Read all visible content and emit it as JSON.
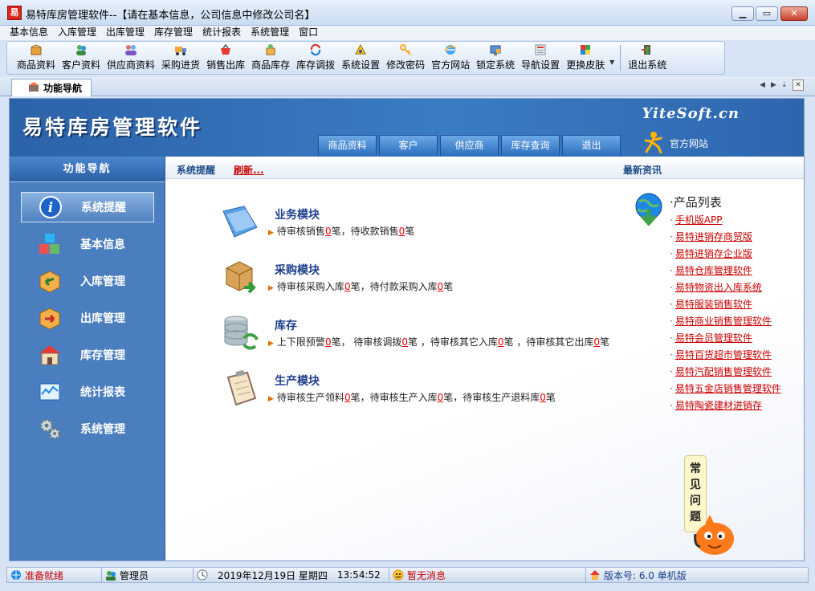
{
  "window": {
    "icon_char": "易",
    "title": "易特库房管理软件--【请在基本信息，公司信息中修改公司名】",
    "minimize": "▁",
    "maximize": "▭",
    "close": "✕"
  },
  "menu": [
    "基本信息",
    "入库管理",
    "出库管理",
    "库存管理",
    "统计报表",
    "系统管理",
    "窗口"
  ],
  "toolbar": [
    {
      "label": "商品资料",
      "icon": "box-icon"
    },
    {
      "label": "客户资料",
      "icon": "customers-icon"
    },
    {
      "label": "供应商资料",
      "icon": "suppliers-icon"
    },
    {
      "label": "采购进货",
      "icon": "truck-icon"
    },
    {
      "label": "销售出库",
      "icon": "basket-icon"
    },
    {
      "label": "商品库存",
      "icon": "stock-icon"
    },
    {
      "label": "库存调拨",
      "icon": "transfer-icon"
    },
    {
      "label": "系统设置",
      "icon": "settings-icon"
    },
    {
      "label": "修改密码",
      "icon": "key-icon"
    },
    {
      "label": "官方网站",
      "icon": "browser-icon"
    },
    {
      "label": "锁定系统",
      "icon": "lock-icon"
    },
    {
      "label": "导航设置",
      "icon": "nav-icon"
    },
    {
      "label": "更换皮肤",
      "icon": "skin-icon"
    },
    {
      "label": "退出系统",
      "icon": "exit-icon"
    }
  ],
  "tab": {
    "label": "功能导航"
  },
  "banner": {
    "title": "易特库房管理软件",
    "brand": "YiteSoft.cn",
    "tabs": [
      "商品资料",
      "客户",
      "供应商",
      "库存查询",
      "退出"
    ],
    "site_label": "官方网站"
  },
  "sidebar": {
    "title": "功能导航",
    "items": [
      "系统提醒",
      "基本信息",
      "入库管理",
      "出库管理",
      "库存管理",
      "统计报表",
      "系统管理"
    ]
  },
  "crumb": {
    "title": "系统提醒",
    "refresh": "刷新...",
    "news": "最新资讯"
  },
  "modules": {
    "business": {
      "title": "业务模块",
      "t1": "待审核销售",
      "n1": "0",
      "t2": "笔，待收款销售",
      "n2": "0",
      "t3": "笔"
    },
    "purchase": {
      "title": "采购模块",
      "t1": "待审核采购入库",
      "n1": "0",
      "t2": "笔，待付款采购入库",
      "n2": "0",
      "t3": "笔"
    },
    "stock": {
      "title": "库存",
      "t1": "上下限预警",
      "n1": "0",
      "t2": "笔，  待审核调拨",
      "n2": "0",
      "t3": "笔 ，待审核其它入库",
      "n3": "0",
      "t4": "笔 ，待审核其它出库",
      "n4": "0",
      "t5": "笔"
    },
    "production": {
      "title": "生产模块",
      "t1": "待审核生产领料",
      "n1": "0",
      "t2": "笔，待审核生产入库",
      "n2": "0",
      "t3": "笔，待审核生产退料库",
      "n3": "0",
      "t4": "笔"
    }
  },
  "products": {
    "heading": "产品列表",
    "items": [
      "手机版APP",
      "易特进销存商贸版",
      "易特进销存企业版",
      "易特仓库管理软件",
      "易特物资出入库系统",
      "易特服装销售软件",
      "易特商业销售管理软件",
      "易特会员管理软件",
      "易特百货超市管理软件",
      "易特汽配销售管理软件",
      "易特五金店销售管理软件",
      "易特陶瓷建材进销存"
    ]
  },
  "faq": {
    "line1": "常",
    "line2": "见",
    "line3": "问",
    "line4": "题"
  },
  "status": {
    "ready": "准备就绪",
    "user": "管理员",
    "date": "2019年12月19日 星期四",
    "time": "13:54:52",
    "messages": "暂无消息",
    "version": "版本号: 6.0 单机版"
  },
  "colors": {
    "accent": "#2c62a8",
    "link_red": "#cc0000",
    "sidebar": "#4a7ebe"
  }
}
